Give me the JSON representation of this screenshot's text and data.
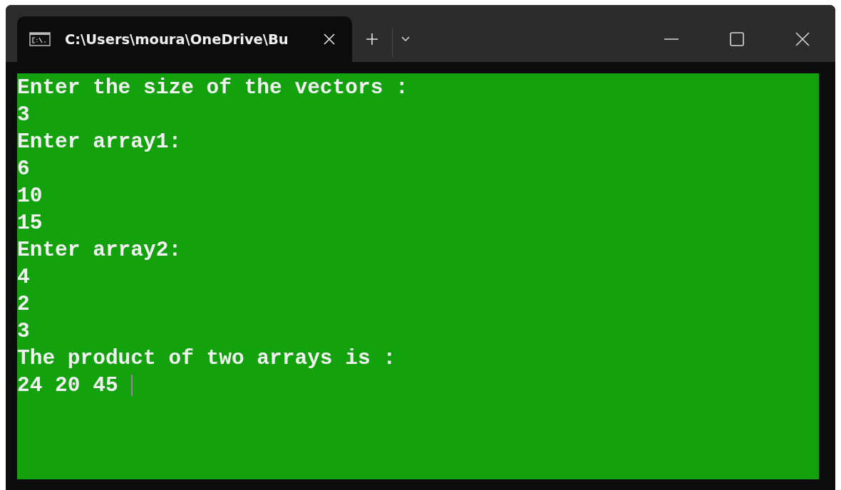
{
  "tabs": [
    {
      "title": "C:\\Users\\moura\\OneDrive\\Bu",
      "selected": true
    }
  ],
  "console": {
    "lines": [
      "Enter the size of the vectors :",
      "3",
      "Enter array1:",
      "6",
      "10",
      "15",
      "Enter array2:",
      "4",
      "2",
      "3",
      "The product of two arrays is :",
      "24 20 45"
    ]
  }
}
